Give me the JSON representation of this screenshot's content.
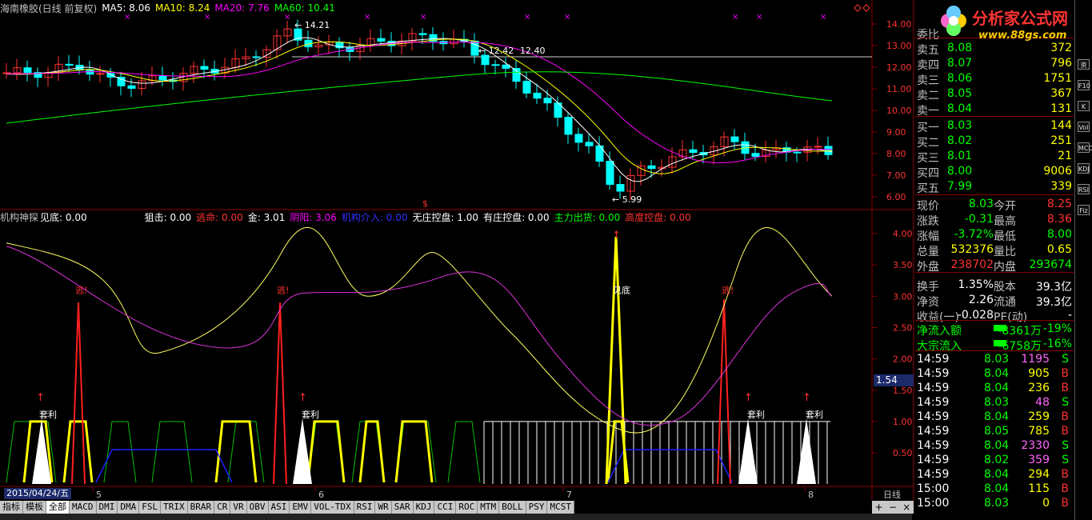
{
  "main_header": {
    "title": "海南橡胶(日线 前复权)",
    "ma5": "MA5: 8.06",
    "ma10": "MA10: 8.24",
    "ma20": "MA20: 7.76",
    "ma60": "MA60: 10.41"
  },
  "price_labels": {
    "high": "14.21",
    "mid_a": "12.42",
    "mid_b": "12.40",
    "low": "5.99",
    "marker": "$"
  },
  "price_axis": [
    "14.00",
    "13.00",
    "12.00",
    "11.00",
    "10.00",
    "9.00",
    "8.00",
    "7.00",
    "6.00"
  ],
  "ind_axis": [
    "4.00",
    "3.50",
    "3.00",
    "2.50",
    "2.00",
    "1.50",
    "1.00",
    "0.50"
  ],
  "indicator": {
    "name": "机构神探",
    "jiandi": "见底: 0.00",
    "juji": "狙击: 0.00",
    "taoming": "逃命: 0.00",
    "jin": "金: 3.01",
    "yinyang": "阴阳: 3.06",
    "jigou": "机构介入: 0.00",
    "wuzhuang": "无庄控盘: 1.00",
    "youzhuang": "有庄控盘: 0.00",
    "zhuli": "主力出货: 0.00",
    "gaodu": "高度控盘: 0.00"
  },
  "chart_annotations": {
    "tao1": "逃!",
    "tao2": "逃!",
    "tao3": "逃!",
    "jiandi": "见底",
    "taoli1": "套利",
    "taoli2": "套利",
    "taoli3": "套利",
    "taoli4": "套利"
  },
  "time_axis": {
    "m5": "5",
    "m6": "6",
    "m7": "7",
    "m8": "8",
    "day": "日线"
  },
  "date_box": "2015/04/24/五",
  "cursor_value": "1.54",
  "order_book": {
    "weibi": "委比",
    "sell": [
      {
        "label": "卖五",
        "price": "8.08",
        "vol": "372"
      },
      {
        "label": "卖四",
        "price": "8.07",
        "vol": "796"
      },
      {
        "label": "卖三",
        "price": "8.06",
        "vol": "1751"
      },
      {
        "label": "卖二",
        "price": "8.05",
        "vol": "367"
      },
      {
        "label": "卖一",
        "price": "8.04",
        "vol": "131"
      }
    ],
    "buy": [
      {
        "label": "买一",
        "price": "8.03",
        "vol": "144"
      },
      {
        "label": "买二",
        "price": "8.02",
        "vol": "251"
      },
      {
        "label": "买三",
        "price": "8.01",
        "vol": "21"
      },
      {
        "label": "买四",
        "price": "8.00",
        "vol": "9006"
      },
      {
        "label": "买五",
        "price": "7.99",
        "vol": "339"
      }
    ]
  },
  "quote": {
    "rows": [
      {
        "l1": "现价",
        "v1": "8.03",
        "l2": "今开",
        "v2": "8.25"
      },
      {
        "l1": "涨跌",
        "v1": "-0.31",
        "l2": "最高",
        "v2": "8.36"
      },
      {
        "l1": "涨幅",
        "v1": "-3.72%",
        "l2": "最低",
        "v2": "8.00"
      },
      {
        "l1": "总量",
        "v1": "532376",
        "l2": "量比",
        "v2": "0.65"
      },
      {
        "l1": "外盘",
        "v1": "238702",
        "l2": "内盘",
        "v2": "293674"
      },
      {
        "l1": "换手",
        "v1": "1.35%",
        "l2": "股本",
        "v2": "39.3亿"
      },
      {
        "l1": "净资",
        "v1": "2.26",
        "l2": "流通",
        "v2": "39.3亿"
      },
      {
        "l1": "收益(一)",
        "v1": "-0.028",
        "l2": "PE(动)",
        "v2": "-"
      }
    ],
    "flow": [
      {
        "l": "净流入额",
        "v": "-8361万",
        "p": "-19%"
      },
      {
        "l": "大宗流入",
        "v": "-6758万",
        "p": "-16%"
      }
    ]
  },
  "ticks": [
    {
      "t": "14:59",
      "p": "8.03",
      "v": "1195",
      "s": "S"
    },
    {
      "t": "14:59",
      "p": "8.04",
      "v": "905",
      "s": "B"
    },
    {
      "t": "14:59",
      "p": "8.04",
      "v": "236",
      "s": "B"
    },
    {
      "t": "14:59",
      "p": "8.03",
      "v": "48",
      "s": "S"
    },
    {
      "t": "14:59",
      "p": "8.04",
      "v": "259",
      "s": "B"
    },
    {
      "t": "14:59",
      "p": "8.05",
      "v": "785",
      "s": "B"
    },
    {
      "t": "14:59",
      "p": "8.04",
      "v": "2330",
      "s": "S"
    },
    {
      "t": "14:59",
      "p": "8.02",
      "v": "359",
      "s": "S"
    },
    {
      "t": "14:59",
      "p": "8.04",
      "v": "294",
      "s": "B"
    },
    {
      "t": "15:00",
      "p": "8.04",
      "v": "115",
      "s": "B"
    },
    {
      "t": "15:00",
      "p": "8.03",
      "v": "0",
      "s": "B"
    }
  ],
  "tabs": [
    "指标",
    "模板",
    "全部",
    "MACD",
    "DMI",
    "DMA",
    "FSL",
    "TRIX",
    "BRAR",
    "CR",
    "VR",
    "OBV",
    "ASI",
    "EMV",
    "VOL-TDX",
    "RSI",
    "WR",
    "SAR",
    "KDJ",
    "CCI",
    "ROC",
    "MTM",
    "BOLL",
    "PSY",
    "MCST"
  ],
  "logo": {
    "text": "分析家公式网",
    "url": "www.88gs.com"
  },
  "side_icons": [
    "资",
    "F10",
    "K",
    "Vol",
    "MCD",
    "KDJ",
    "RSI",
    "Fiz"
  ],
  "colors": {
    "up": "#ff3232",
    "down": "#00ffff",
    "ma5": "#ffffff",
    "ma10": "#ffff00",
    "ma20": "#ff00ff",
    "ma60": "#00ff00"
  }
}
